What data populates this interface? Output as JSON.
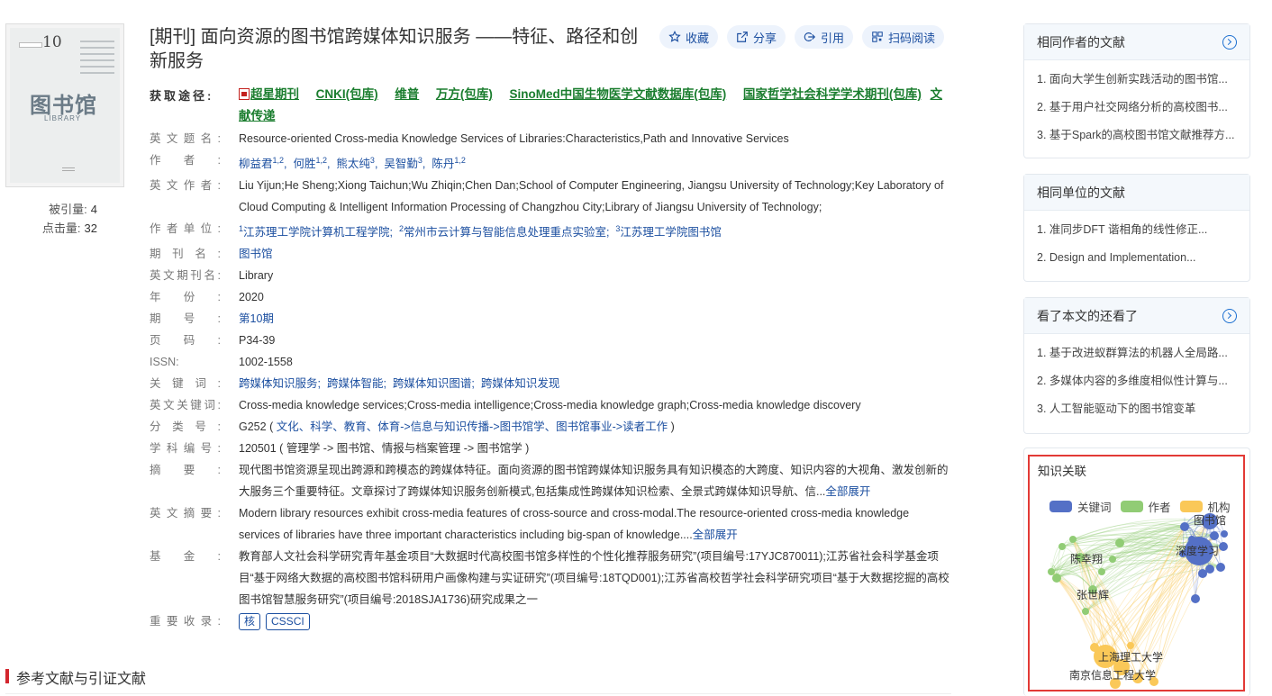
{
  "cover": {
    "issue_number": "10",
    "title": "图书馆",
    "subtitle": "LIBRARY"
  },
  "stats": {
    "cited_label": "被引量:",
    "cited_value": "4",
    "clicks_label": "点击量:",
    "clicks_value": "32"
  },
  "article": {
    "title": "[期刊] 面向资源的图书馆跨媒体知识服务 ——特征、路径和创新服务",
    "actions": {
      "favorite": "收藏",
      "share": "分享",
      "cite": "引用",
      "scan": "扫码阅读"
    },
    "channels_label": "获取途径:",
    "channels": [
      "超星期刊",
      "CNKI(包库)",
      "维普",
      "万方(包库)",
      "SinoMed中国生物医学文献数据库(包库)",
      "国家哲学社会科学学术期刊(包库)",
      "文献传递"
    ],
    "fields": {
      "en_title_label": "英文题名:",
      "en_title": "Resource-oriented Cross-media Knowledge Services of Libraries:Characteristics,Path and Innovative Services",
      "authors_label": "作者:",
      "authors": [
        {
          "name": "柳益君",
          "sup": "1,2"
        },
        {
          "name": "何胜",
          "sup": "1,2"
        },
        {
          "name": "熊太纯",
          "sup": "3"
        },
        {
          "name": "吴智勤",
          "sup": "3"
        },
        {
          "name": "陈丹",
          "sup": "1,2"
        }
      ],
      "en_authors_label": "英文作者:",
      "en_authors": "Liu Yijun;He Sheng;Xiong Taichun;Wu Zhiqin;Chen Dan;School of Computer Engineering, Jiangsu University of Technology;Key Laboratory of Cloud Computing & Intelligent Information Processing of Changzhou City;Library of Jiangsu University of Technology;",
      "affiliation_label": "作者单位:",
      "affiliations": [
        {
          "sup": "1",
          "name": "江苏理工学院计算机工程学院"
        },
        {
          "sup": "2",
          "name": "常州市云计算与智能信息处理重点实验室"
        },
        {
          "sup": "3",
          "name": "江苏理工学院图书馆"
        }
      ],
      "journal_label": "期刊名:",
      "journal": "图书馆",
      "en_journal_label": "英文期刊名:",
      "en_journal": "Library",
      "year_label": "年份:",
      "year": "2020",
      "issue_label": "期号:",
      "issue": "第10期",
      "pages_label": "页码:",
      "pages": "P34-39",
      "issn_label": "ISSN:",
      "issn": "1002-1558",
      "keywords_label": "关键词:",
      "keywords": [
        "跨媒体知识服务",
        "跨媒体智能",
        "跨媒体知识图谱",
        "跨媒体知识发现"
      ],
      "en_keywords_label": "英文关键词:",
      "en_keywords": "Cross-media knowledge services;Cross-media intelligence;Cross-media knowledge graph;Cross-media knowledge discovery",
      "class_label": "分类号:",
      "class_code": "G252",
      "class_path": "文化、科学、教育、体育->信息与知识传播->图书馆学、图书馆事业->读者工作",
      "subject_label": "学科编号:",
      "subject": "120501 ( 管理学 -> 图书馆、情报与档案管理 -> 图书馆学 )",
      "abstract_label": "摘要:",
      "abstract": "现代图书馆资源呈现出跨源和跨模态的跨媒体特征。面向资源的图书馆跨媒体知识服务具有知识模态的大跨度、知识内容的大视角、激发创新的大服务三个重要特征。文章探讨了跨媒体知识服务创新模式,包括集成性跨媒体知识检索、全景式跨媒体知识导航、信...",
      "expand_all": "全部展开",
      "en_abstract_label": "英文摘要:",
      "en_abstract": "Modern library resources exhibit cross-media features of cross-source and cross-modal.The resource-oriented cross-media knowledge services of libraries have three important characteristics including big-span of knowledge....",
      "fund_label": "基金:",
      "fund": "教育部人文社会科学研究青年基金项目“大数据时代高校图书馆多样性的个性化推荐服务研究”(项目编号:17YJC870011);江苏省社会科学基金项目“基于网络大数据的高校图书馆科研用户画像构建与实证研究”(项目编号:18TQD001);江苏省高校哲学社会科学研究项目“基于大数据挖掘的高校图书馆智慧服务研究”(项目编号:2018SJA1736)研究成果之一",
      "indexed_label": "重要收录:",
      "indexed": [
        "核",
        "CSSCI"
      ]
    }
  },
  "references_heading": "参考文献与引证文献",
  "sidebar": {
    "same_author": {
      "title": "相同作者的文献",
      "items": [
        "1. 面向大学生创新实践活动的图书馆...",
        "2. 基于用户社交网络分析的高校图书...",
        "3. 基于Spark的高校图书馆文献推荐方..."
      ]
    },
    "same_unit": {
      "title": "相同单位的文献",
      "items": [
        "1. 准同步DFT 谐相角的线性修正...",
        "2. Design and Implementation..."
      ]
    },
    "also_viewed": {
      "title": "看了本文的还看了",
      "items": [
        "1. 基于改进蚁群算法的机器人全局路...",
        "2. 多媒体内容的多维度相似性计算与...",
        "3. 人工智能驱动下的图书馆变革"
      ]
    }
  },
  "knowledge_graph": {
    "title": "知识关联",
    "legend": [
      {
        "label": "关键词",
        "color": "#5470c6"
      },
      {
        "label": "作者",
        "color": "#91cc75"
      },
      {
        "label": "机构",
        "color": "#fac858"
      }
    ],
    "node_labels": [
      "图书馆",
      "深度学习",
      "陈幸翔",
      "张世辉",
      "上海理工大学",
      "南京信息工程大学"
    ]
  }
}
